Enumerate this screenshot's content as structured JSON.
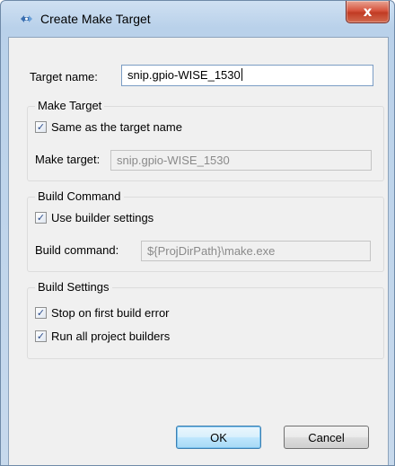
{
  "window": {
    "title": "Create Make Target",
    "close_glyph": "x",
    "title_icon": "make-target-icon"
  },
  "target_name": {
    "label": "Target name:",
    "value": "snip.gpio-WISE_1530"
  },
  "make_target_group": {
    "title": "Make Target",
    "checkbox_label": "Same as the target name",
    "checked": true,
    "field_label": "Make target:",
    "field_value": "snip.gpio-WISE_1530"
  },
  "build_command_group": {
    "title": "Build Command",
    "checkbox_label": "Use builder settings",
    "checked": true,
    "field_label": "Build command:",
    "field_value": "${ProjDirPath}\\make.exe"
  },
  "build_settings_group": {
    "title": "Build Settings",
    "options": [
      {
        "label": "Stop on first build error",
        "checked": true
      },
      {
        "label": "Run all project builders",
        "checked": true
      }
    ]
  },
  "buttons": {
    "ok_label": "OK",
    "cancel_label": "Cancel"
  },
  "check_glyph": "✓",
  "colors": {
    "title_bar": "#b9d1ea",
    "close_button": "#c13b24",
    "default_button_border": "#3c7fb1",
    "dialog_background": "#f0f0f0"
  }
}
